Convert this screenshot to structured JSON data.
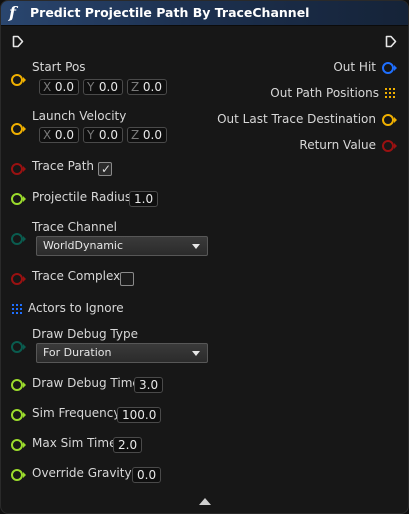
{
  "node": {
    "title": "Predict Projectile Path By TraceChannel",
    "function_icon_glyph": "f",
    "colors": {
      "header_start": "#2a466f",
      "vector_pin": "#f0b000",
      "bool_pin": "#9a1111",
      "float_pin": "#9bdb2c",
      "enum_pin": "#0a5c4f",
      "object_pin": "#1f6fff",
      "struct_pin": "#f0b000"
    }
  },
  "inputs": {
    "start_pos": {
      "label": "Start Pos",
      "x": "0.0",
      "y": "0.0",
      "z": "0.0"
    },
    "launch_velocity": {
      "label": "Launch Velocity",
      "x": "0.0",
      "y": "0.0",
      "z": "0.0"
    },
    "trace_path": {
      "label": "Trace Path",
      "checked": true,
      "check_glyph": "✓"
    },
    "projectile_radius": {
      "label": "Projectile Radius",
      "value": "1.0"
    },
    "trace_channel": {
      "label": "Trace Channel",
      "selected": "WorldDynamic"
    },
    "trace_complex": {
      "label": "Trace Complex",
      "checked": false
    },
    "actors_to_ignore": {
      "label": "Actors to Ignore"
    },
    "draw_debug_type": {
      "label": "Draw Debug Type",
      "selected": "For Duration"
    },
    "draw_debug_time": {
      "label": "Draw Debug Time",
      "value": "3.0"
    },
    "sim_frequency": {
      "label": "Sim Frequency",
      "value": "100.0"
    },
    "max_sim_time": {
      "label": "Max Sim Time",
      "value": "2.0"
    },
    "override_gravity_z": {
      "label": "Override Gravity Z",
      "value": "0.0"
    }
  },
  "axis_labels": {
    "x": "X",
    "y": "Y",
    "z": "Z"
  },
  "outputs": {
    "out_hit": "Out Hit",
    "out_path_positions": "Out Path Positions",
    "out_last_trace_destination": "Out Last Trace Destination",
    "return_value": "Return Value"
  }
}
